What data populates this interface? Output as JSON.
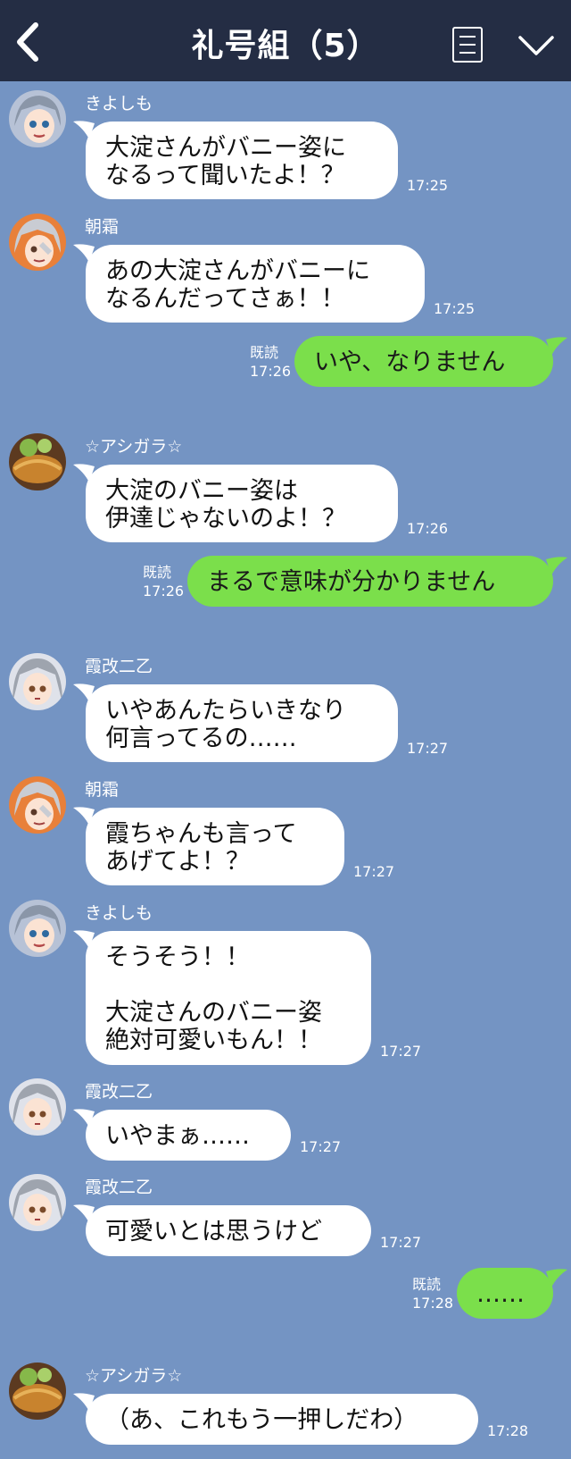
{
  "header": {
    "title": "礼号組（5）"
  },
  "icons": {
    "back": "chevron-left-icon",
    "menu": "menu-list-icon",
    "expand": "chevron-down-icon"
  },
  "colors": {
    "header_bg": "#242d44",
    "chat_bg": "#7494c3",
    "bubble_in": "#ffffff",
    "bubble_out": "#7bdf4b"
  },
  "messages": [
    {
      "sender": "きよしも",
      "text": "大淀さんがバニー姿に\nなるって聞いたよ！？",
      "time": "17:25"
    },
    {
      "sender": "朝霜",
      "text": "あの大淀さんがバニーに\nなるんだってさぁ！！",
      "time": "17:25"
    },
    {
      "read": "既読",
      "text": "いや、なりません",
      "time": "17:26"
    },
    {
      "sender": "☆アシガラ☆",
      "text": "大淀のバニー姿は\n伊達じゃないのよ！？",
      "time": "17:26"
    },
    {
      "read": "既読",
      "text": "まるで意味が分かりません",
      "time": "17:26"
    },
    {
      "sender": "霞改二乙",
      "text": "いやあんたらいきなり\n何言ってるの……",
      "time": "17:27"
    },
    {
      "sender": "朝霜",
      "text": "霞ちゃんも言って\nあげてよ！？",
      "time": "17:27"
    },
    {
      "sender": "きよしも",
      "text": "そうそう！！\n\n大淀さんのバニー姿\n絶対可愛いもん！！",
      "time": "17:27"
    },
    {
      "sender": "霞改二乙",
      "text": "いやまぁ……",
      "time": "17:27"
    },
    {
      "sender": "霞改二乙",
      "text": "可愛いとは思うけど",
      "time": "17:27"
    },
    {
      "read": "既読",
      "text": "……",
      "time": "17:28"
    },
    {
      "sender": "☆アシガラ☆",
      "text": "（あ、これもう一押しだわ）",
      "time": "17:28"
    }
  ]
}
